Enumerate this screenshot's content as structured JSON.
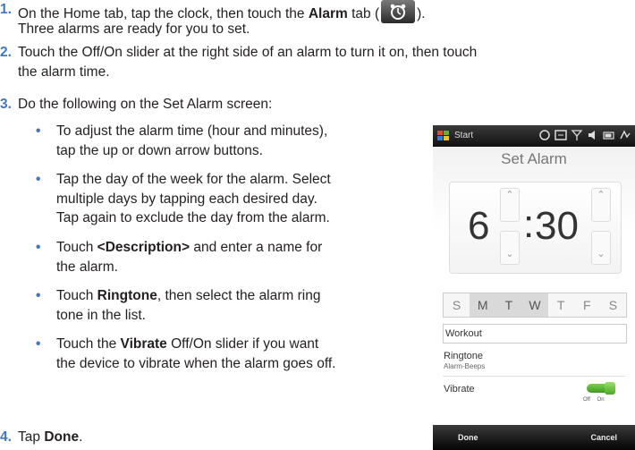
{
  "steps": [
    {
      "num": "1.",
      "parts": [
        "On the Home tab, tap the clock, then touch the ",
        "Alarm",
        " tab (",
        ")."
      ],
      "line2": "Three alarms are ready for you to set."
    },
    {
      "num": "2.",
      "line1": "Touch the Off/On slider at the right side of an alarm to turn it on, then touch",
      "line2": "the alarm time."
    },
    {
      "num": "3.",
      "line1": "Do the following on the Set Alarm screen:"
    },
    {
      "num": "4.",
      "parts": [
        "Tap ",
        "Done",
        "."
      ]
    }
  ],
  "bullets": [
    {
      "lines": [
        "To adjust the alarm time (hour and minutes),",
        "tap the up or down arrow buttons."
      ]
    },
    {
      "lines": [
        "Tap the day of the week for the alarm. Select",
        "multiple days by tapping each desired day.",
        "Tap again to exclude the day from the alarm."
      ]
    },
    {
      "parts": [
        "Touch ",
        "<Description>",
        " and enter a name for"
      ],
      "line2": "the alarm."
    },
    {
      "parts": [
        "Touch ",
        "Ringtone",
        ", then select the alarm ring"
      ],
      "line2": "tone in the list."
    },
    {
      "parts": [
        "Touch the ",
        "Vibrate",
        " Off/On slider if you want"
      ],
      "line2": "the device to vibrate when the alarm goes off."
    }
  ],
  "bullet_char": "•",
  "phone": {
    "status_start": "Start",
    "screen_title": "Set Alarm",
    "hour": "6",
    "colon": ":",
    "minutes": "30",
    "days": [
      "S",
      "M",
      "T",
      "W",
      "T",
      "F",
      "S"
    ],
    "selected_days": [
      1,
      2,
      3
    ],
    "description": "Workout",
    "ringtone_label": "Ringtone",
    "ringtone_value": "Alarm-Beeps",
    "vibrate_label": "Vibrate",
    "vibrate_state": "on",
    "off_on": "Off On",
    "softkey_left": "Done",
    "softkey_right": "Cancel"
  },
  "colors": {
    "accent": "#3f76c9",
    "toggle_green": "#4aaa2a"
  }
}
